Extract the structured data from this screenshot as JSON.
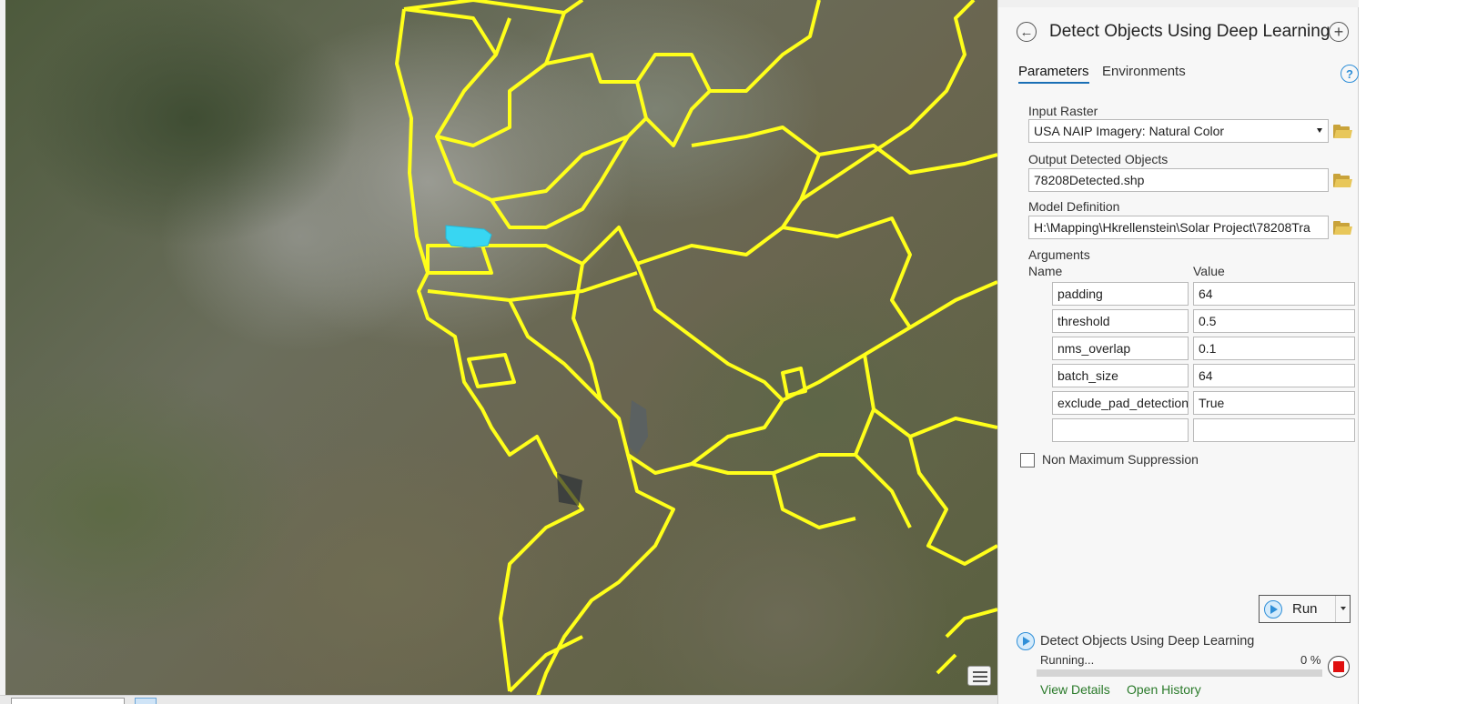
{
  "tool": {
    "title": "Detect Objects Using Deep Learning",
    "back_icon": "back-arrow-icon",
    "add_icon": "plus-icon"
  },
  "tabs": [
    {
      "label": "Parameters",
      "active": true
    },
    {
      "label": "Environments",
      "active": false
    }
  ],
  "help_label": "?",
  "parameters": {
    "input_raster": {
      "label": "Input Raster",
      "value": "USA NAIP Imagery: Natural Color"
    },
    "output_objects": {
      "label": "Output Detected Objects",
      "value": "78208Detected.shp"
    },
    "model_definition": {
      "label": "Model Definition",
      "value": "H:\\Mapping\\Hkrellenstein\\Solar Project\\78208Tra"
    },
    "arguments": {
      "label": "Arguments",
      "name_header": "Name",
      "value_header": "Value",
      "rows": [
        {
          "name": "padding",
          "value": "64"
        },
        {
          "name": "threshold",
          "value": "0.5"
        },
        {
          "name": "nms_overlap",
          "value": "0.1"
        },
        {
          "name": "batch_size",
          "value": "64"
        },
        {
          "name": "exclude_pad_detections",
          "value": "True"
        },
        {
          "name": "",
          "value": ""
        }
      ]
    },
    "nms": {
      "label": "Non Maximum Suppression",
      "checked": false
    }
  },
  "run_button": {
    "label": "Run"
  },
  "progress": {
    "tool_name": "Detect Objects Using Deep Learning",
    "status": "Running...",
    "percent_label": "0 %",
    "percent": 0
  },
  "links": {
    "view_details": "View Details",
    "open_history": "Open History"
  },
  "colors": {
    "boundary": "#ffff1a",
    "selected_area": "#38d6f2",
    "accent": "#2f8fd8",
    "stop": "#e01010"
  }
}
